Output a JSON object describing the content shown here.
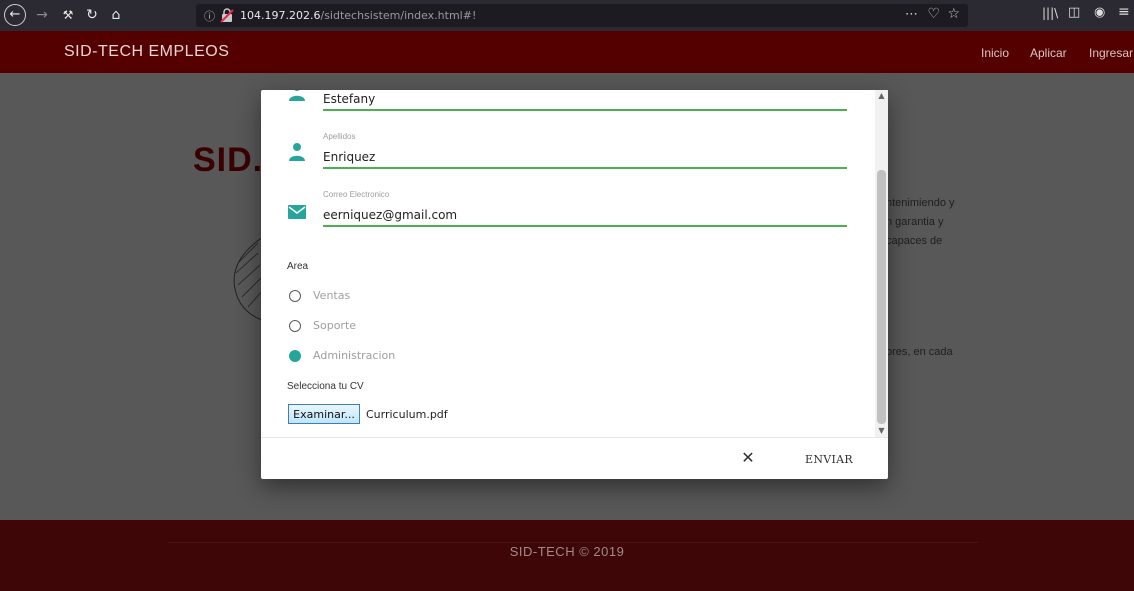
{
  "browser": {
    "url_host": "104.197.202.6",
    "url_path": "/sidtechsistem/index.html#!",
    "page_actions": "⋯",
    "back": "←",
    "forward": "→",
    "tools": "⚒",
    "reload": "↻",
    "home": "⌂",
    "info": "ⓘ",
    "pocket": "♡",
    "bookmark": "☆",
    "library": "|||\\",
    "sidebar": "◫",
    "account": "◉",
    "menu": "≡"
  },
  "navbar": {
    "brand": "SID-TECH EMPLEOS",
    "links": [
      "Inicio",
      "Aplicar",
      "Ingresar"
    ],
    "bg_color": "#540000"
  },
  "background": {
    "logo_text": "SID.",
    "text_lines": [
      "ntenimiendo y",
      "n garantia y",
      "capaces de",
      "ores, en cada"
    ]
  },
  "form": {
    "nombre_value": "Estefany",
    "apellidos_label": "Apellidos",
    "apellidos_value": "Enriquez",
    "correo_label": "Correo Electronico",
    "correo_value": "eerniquez@gmail.com",
    "area_label": "Area",
    "area_options": [
      {
        "label": "Ventas",
        "checked": false
      },
      {
        "label": "Soporte",
        "checked": false
      },
      {
        "label": "Administracion",
        "checked": true
      }
    ],
    "cv_label": "Selecciona tu CV",
    "browse_label": "Examinar...",
    "file_name": "Curriculum.pdf",
    "accent_color": "#26a69a",
    "underline_color": "#4caf50"
  },
  "modal_footer": {
    "close_label": "✕",
    "submit_label": "ENVIAR"
  },
  "footer": {
    "text": "SID-TECH © 2019",
    "bg_color": "#3e0606"
  }
}
